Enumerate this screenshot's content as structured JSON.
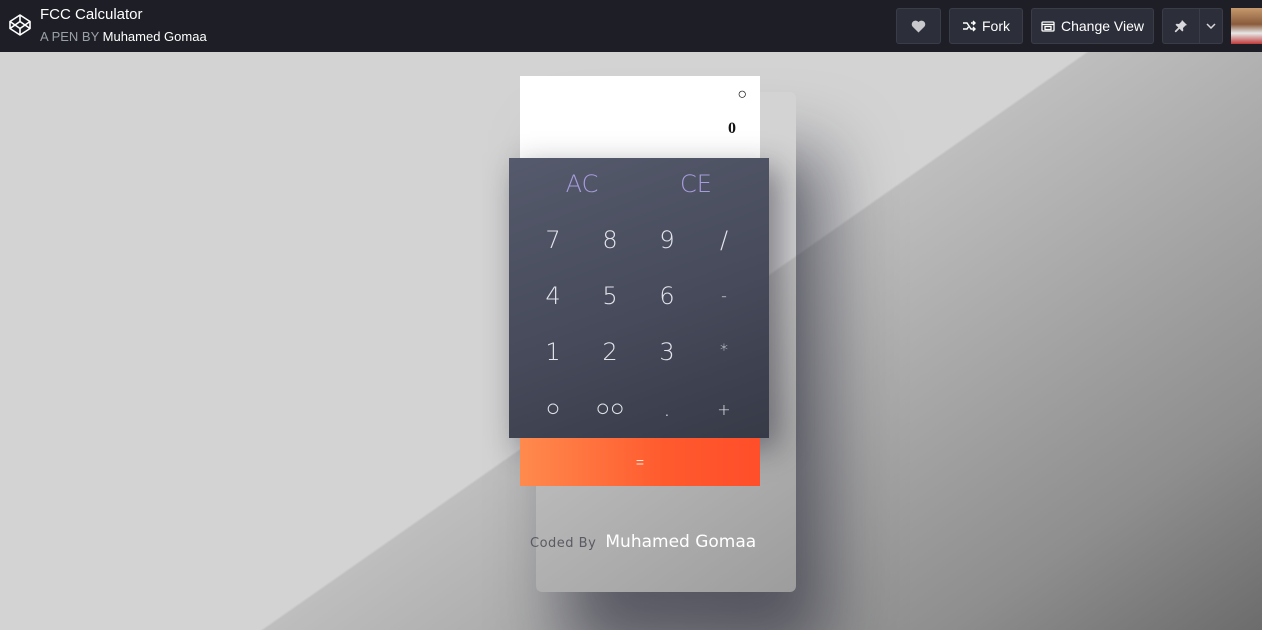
{
  "header": {
    "title": "FCC Calculator",
    "byline_prefix": "A PEN BY",
    "author": "Muhamed Gomaa",
    "buttons": {
      "fork": "Fork",
      "change_view": "Change View"
    },
    "icons": [
      "codepen-logo-icon",
      "heart-icon",
      "fork-icon",
      "change-view-icon",
      "pin-icon",
      "chevron-down-icon"
    ]
  },
  "calculator": {
    "display": {
      "history": "○",
      "current": "0"
    },
    "clear_keys": [
      "AC",
      "CE"
    ],
    "rows": [
      [
        "7",
        "8",
        "9",
        "/"
      ],
      [
        "4",
        "5",
        "6",
        "-"
      ],
      [
        "1",
        "2",
        "3",
        "*"
      ],
      [
        "○",
        "○○",
        ".",
        "+"
      ]
    ],
    "equals": "=",
    "colors": {
      "keypad": "#4a4e5e",
      "clear_text": "#a79cdd",
      "equals_start": "#ff8a4e",
      "equals_end": "#ff4e2a"
    }
  },
  "footer": {
    "prefix": "Coded By",
    "name": "Muhamed Gomaa"
  }
}
